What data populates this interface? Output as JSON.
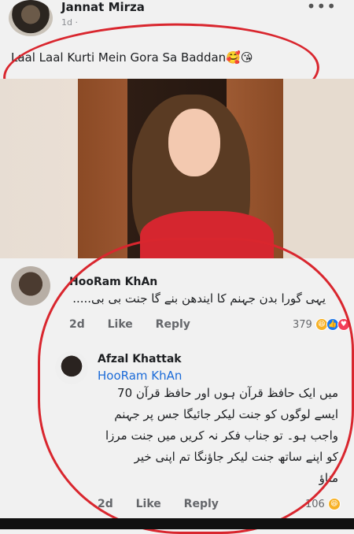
{
  "post": {
    "author": "Jannat Mirza",
    "meta": "1d ·",
    "more": "•••",
    "caption": "Laal Laal Kurti Mein Gora Sa Baddan🥰😘"
  },
  "comment1": {
    "author": "HooRam KhAn",
    "text": "یہی گورا بدن جہنم کا ایندھن بنے گا جنت بی بی.....",
    "time": "2d",
    "like": "Like",
    "reply": "Reply",
    "reaction_count": "379"
  },
  "comment2": {
    "author": "Afzal Khattak",
    "mention": "HooRam KhAn",
    "lines": [
      "میں ایک حافظ قرآن ہوں اور حافظ قرآن 70",
      "ایسے لوگوں کو جنت لیکر جائیگا جس پر جہنم",
      "واجب ہو۔ تو جناب فکر نہ کریں میں جنت مرزا",
      "کو اپنے ساتھ جنت لیکر جاؤنگا تم اپنی خیر",
      "مناؤ"
    ],
    "time": "2d",
    "like": "Like",
    "reply": "Reply",
    "reaction_count": "106"
  },
  "colors": {
    "annotation": "#d9262e",
    "link": "#1b6bd8"
  }
}
